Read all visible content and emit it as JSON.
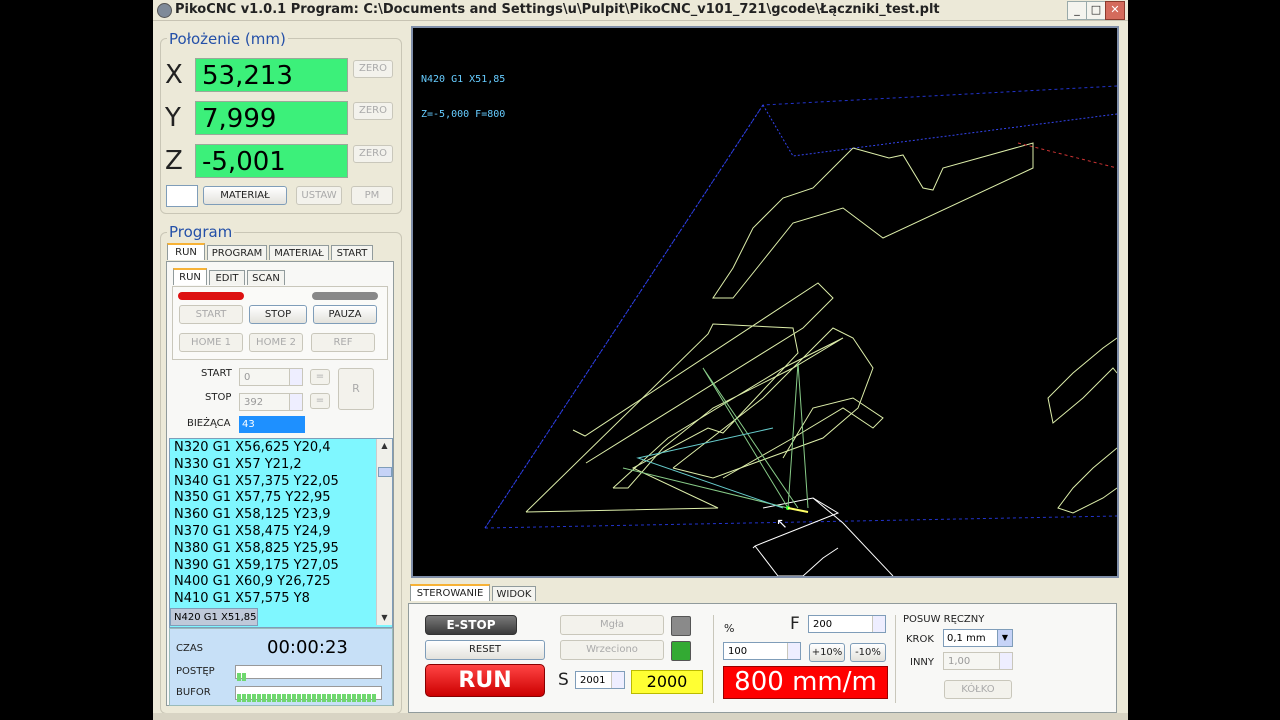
{
  "window": {
    "title": "PikoCNC v1.0.1   Program: C:\\Documents and Settings\\u\\Pulpit\\PikoCNC_v101_721\\gcode\\Łączniki_test.plt",
    "min_label": "_",
    "max_label": "□",
    "close_label": "✕"
  },
  "position": {
    "legend": "Położenie (mm)",
    "x_label": "X",
    "x_value": "53,213",
    "y_label": "Y",
    "y_value": "7,999",
    "z_label": "Z",
    "z_value": "-5,001",
    "zero_label": "ZERO",
    "material_label": "MATERIAŁ",
    "ustaw_label": "USTAW",
    "pm_label": "PM"
  },
  "program": {
    "legend": "Program",
    "tabs": [
      "RUN",
      "PROGRAM",
      "MATERIAŁ",
      "START"
    ],
    "subtabs": [
      "RUN",
      "EDIT",
      "SCAN"
    ],
    "start_label": "START",
    "stop_label": "STOP",
    "pauza_label": "PAUZA",
    "home1_label": "HOME 1",
    "home2_label": "HOME 2",
    "ref_label": "REF",
    "start_field_label": "START",
    "start_field_value": "0",
    "stop_field_label": "STOP",
    "stop_field_value": "392",
    "eq_label": "=",
    "r_label": "R",
    "current_label": "BIEŻĄCA",
    "current_value": "43",
    "lines": [
      "N320 G1 X56,625 Y20,4",
      "N330 G1 X57 Y21,2",
      "N340 G1 X57,375 Y22,05",
      "N350 G1 X57,75 Y22,95",
      "N360 G1 X58,125 Y23,9",
      "N370 G1 X58,475 Y24,9",
      "N380 G1 X58,825 Y25,95",
      "N390 G1 X59,175 Y27,05",
      "N400 G1 X60,9 Y26,725",
      "N410 G1 X57,575 Y8",
      "N420 G1 X51,85"
    ],
    "czas_label": "CZAS",
    "czas_value": "00:00:23",
    "postep_label": "POSTĘP",
    "postep_fraction": 0.06,
    "bufor_label": "BUFOR",
    "bufor_fraction": 1.0
  },
  "viewport": {
    "line1": "N420 G1 X51,85",
    "line2": "Z=-5,000 F=800"
  },
  "control": {
    "tabs": [
      "STEROWANIE",
      "WIDOK"
    ],
    "estop_label": "E-STOP",
    "reset_label": "RESET",
    "run_label": "RUN",
    "mgla_label": "Mgła",
    "wrzeciono_label": "Wrzeciono",
    "s_label": "S",
    "s_value": "2001",
    "s_display": "2000",
    "percent_label": "%",
    "percent_value": "100",
    "f_label": "F",
    "f_value": "200",
    "plus10_label": "+10%",
    "minus10_label": "-10%",
    "feed_display": "800 mm/m",
    "posuw_label": "POSUW RĘCZNY",
    "krok_label": "KROK",
    "krok_value": "0,1 mm",
    "inny_label": "INNY",
    "inny_value": "1,00",
    "kolko_label": "KÓŁKO",
    "led_colors": {
      "mgla": "#8a8a8a",
      "wrzeciono": "#33aa33"
    }
  }
}
